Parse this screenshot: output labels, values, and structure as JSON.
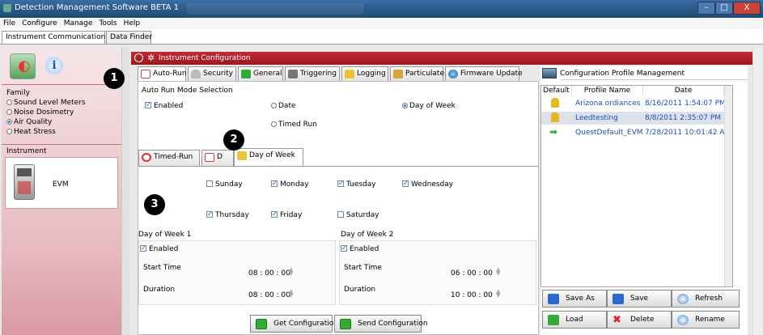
{
  "window": {
    "title": "Detection Management Software BETA 1",
    "buttons": [
      "–",
      "□",
      "X"
    ]
  },
  "menu": [
    "File",
    "Configure",
    "Manage",
    "Tools",
    "Help"
  ],
  "top_tabs": [
    "Instrument Communications",
    "Data Finder"
  ],
  "sidebar": {
    "family_label": "Family",
    "family_options": [
      {
        "label": "Sound Level Meters",
        "selected": false
      },
      {
        "label": "Noise Dosimetry",
        "selected": false
      },
      {
        "label": "Air Quality",
        "selected": true
      },
      {
        "label": "Heat Stress",
        "selected": false
      }
    ],
    "instrument_label": "Instrument",
    "instrument_name": "EVM"
  },
  "instrument_config": {
    "header": "Instrument Configuration",
    "tabs": [
      "Auto-Run",
      "Security",
      "General",
      "Triggering",
      "Logging",
      "Particulate",
      "Firmware Update"
    ],
    "auto_run": {
      "section_label": "Auto Run Mode Selection",
      "enabled_label": "Enabled",
      "enabled_checked": true,
      "mode_options": [
        {
          "label": "Date",
          "selected": false
        },
        {
          "label": "Day of Week",
          "selected": true
        },
        {
          "label": "Timed Run",
          "selected": false
        }
      ]
    },
    "subtabs": [
      "Timed-Run",
      "D",
      "Day of Week"
    ],
    "days": [
      {
        "label": "Sunday",
        "checked": false
      },
      {
        "label": "Monday",
        "checked": true
      },
      {
        "label": "Tuesday",
        "checked": true
      },
      {
        "label": "Wednesday",
        "checked": true
      },
      {
        "label": "Thursday",
        "checked": true
      },
      {
        "label": "Friday",
        "checked": true
      },
      {
        "label": "Saturday",
        "checked": false
      }
    ],
    "dow1": {
      "title": "Day of Week 1",
      "enabled_label": "Enabled",
      "enabled_checked": true,
      "start_label": "Start Time",
      "start_value": "08 : 00 : 00",
      "duration_label": "Duration",
      "duration_value": "08 : 00 : 00"
    },
    "dow2": {
      "title": "Day of Week 2",
      "enabled_label": "Enabled",
      "enabled_checked": true,
      "start_label": "Start Time",
      "start_value": "06 : 00 : 00",
      "duration_label": "Duration",
      "duration_value": "10 : 00 : 00"
    },
    "get_button": "Get Configuration",
    "send_button": "Send Configuration"
  },
  "profiles": {
    "title": "Configuration Profile Management",
    "columns": [
      "Default",
      "Profile Name",
      "Date"
    ],
    "rows": [
      {
        "name": "Arizona ordiances",
        "date": "8/16/2011 1:54:07 PM"
      },
      {
        "name": "Leedtesting",
        "date": "8/8/2011 2:35:07 PM"
      },
      {
        "name": "QuestDefault_EVM",
        "date": "7/28/2011 10:01:42 AM"
      }
    ],
    "buttons": [
      "Save As",
      "Save",
      "Refresh",
      "Load",
      "Delete",
      "Rename"
    ]
  },
  "callouts": [
    "1",
    "2",
    "3"
  ],
  "colors": {
    "accent": "#a31d26",
    "link": "#1a4fb5"
  }
}
